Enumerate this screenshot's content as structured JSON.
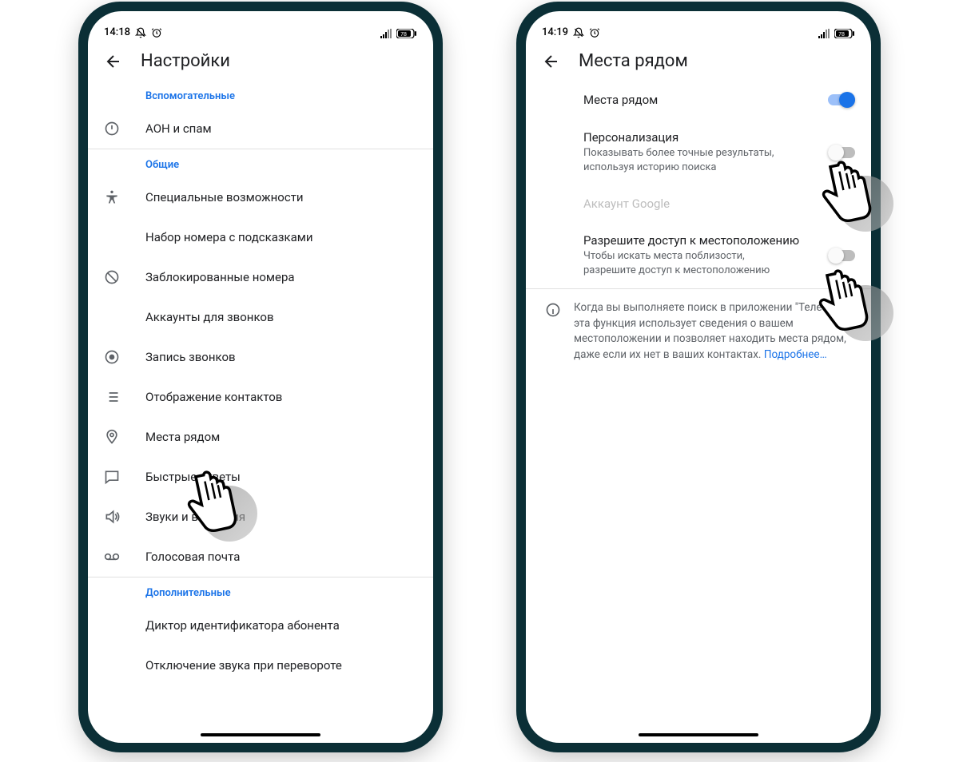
{
  "leftPhone": {
    "status": {
      "time": "14:18"
    },
    "header": {
      "title": "Настройки"
    },
    "sections": {
      "aux": {
        "header": "Вспомогательные",
        "items": {
          "callerSpam": "АОН и спам"
        }
      },
      "general": {
        "header": "Общие",
        "items": {
          "accessibility": "Специальные возможности",
          "assistedDial": "Набор номера с подсказками",
          "blocked": "Заблокированные номера",
          "callAccounts": "Аккаунты для звонков",
          "recording": "Запись звонков",
          "displayContacts": "Отображение контактов",
          "nearby": "Места рядом",
          "quick": "Быстрые ответы",
          "sounds": "Звуки и вибрация",
          "voicemail": "Голосовая почта"
        }
      },
      "extra": {
        "header": "Дополнительные",
        "items": {
          "callerAnnounce": "Диктор идентификатора абонента",
          "flipMute": "Отключение звука при перевороте"
        }
      }
    }
  },
  "rightPhone": {
    "status": {
      "time": "14:19"
    },
    "header": {
      "title": "Места рядом"
    },
    "rows": {
      "nearby": {
        "title": "Места рядом"
      },
      "personalization": {
        "title": "Персонализация",
        "sub": "Показывать более точные результаты, используя историю поиска"
      },
      "googleAccount": {
        "title": "Аккаунт Google"
      },
      "locationAccess": {
        "title": "Разрешите доступ к местоположению",
        "sub": "Чтобы искать места поблизости, разрешите доступ к местоположению"
      }
    },
    "info": {
      "text": "Когда вы выполняете поиск в приложении \"Телефон\", эта функция использует сведения о вашем местоположении и позволяет находить места рядом, даже если их нет в ваших контактах. ",
      "link": "Подробнее…"
    }
  }
}
